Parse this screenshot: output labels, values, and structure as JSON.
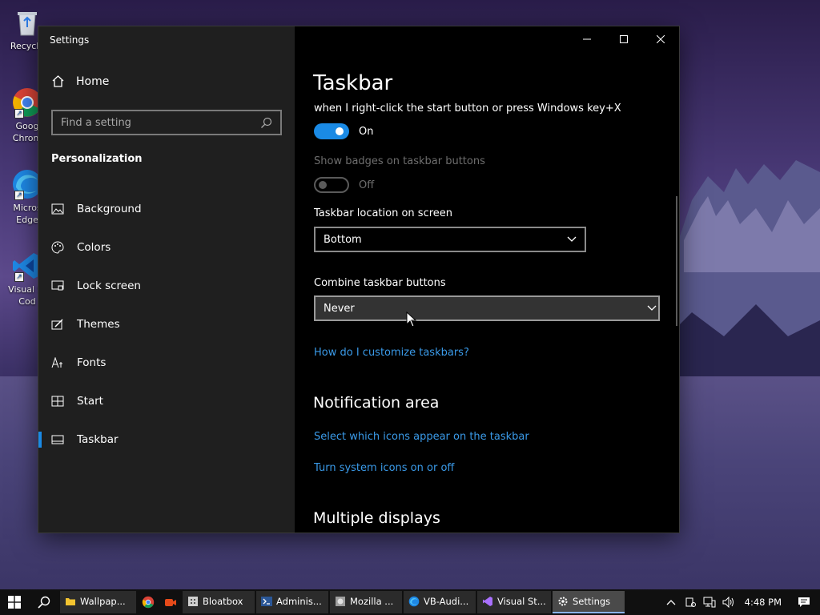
{
  "desktop": {
    "icons": [
      {
        "label": "Recycle"
      },
      {
        "label": "Goog\nChrom"
      },
      {
        "label": "Micros\nEdge"
      },
      {
        "label": "Visual St\nCod"
      }
    ]
  },
  "window": {
    "title": "Settings",
    "controls": {
      "minimize": "minimize-icon",
      "maximize": "maximize-icon",
      "close": "close-icon"
    }
  },
  "sidebar": {
    "home_label": "Home",
    "search_placeholder": "Find a setting",
    "section": "Personalization",
    "items": [
      {
        "label": "Background",
        "icon": "picture-icon"
      },
      {
        "label": "Colors",
        "icon": "palette-icon"
      },
      {
        "label": "Lock screen",
        "icon": "lock-screen-icon"
      },
      {
        "label": "Themes",
        "icon": "brush-icon"
      },
      {
        "label": "Fonts",
        "icon": "font-icon"
      },
      {
        "label": "Start",
        "icon": "start-tiles-icon"
      },
      {
        "label": "Taskbar",
        "icon": "taskbar-icon",
        "active": true
      }
    ]
  },
  "content": {
    "title": "Taskbar",
    "powershell_desc": "when I right-click the start button or press Windows key+X",
    "powershell_toggle": {
      "state": "On"
    },
    "badges_label": "Show badges on taskbar buttons",
    "badges_toggle": {
      "state": "Off"
    },
    "location_label": "Taskbar location on screen",
    "location_value": "Bottom",
    "combine_label": "Combine taskbar buttons",
    "combine_value": "Never",
    "help_link": "How do I customize taskbars?",
    "notification_heading": "Notification area",
    "notif_link1": "Select which icons appear on the taskbar",
    "notif_link2": "Turn system icons on or off",
    "multiple_heading": "Multiple displays"
  },
  "taskbar": {
    "apps": [
      {
        "label": "Wallpap...",
        "icon": "folder-icon"
      },
      {
        "label": "Bloatbox",
        "icon": "bloatbox-icon"
      },
      {
        "label": "Adminis...",
        "icon": "powershell-icon"
      },
      {
        "label": "Mozilla ...",
        "icon": "mozilla-icon"
      },
      {
        "label": "VB-Audi...",
        "icon": "edge-icon"
      },
      {
        "label": "Visual St...",
        "icon": "visual-studio-icon"
      },
      {
        "label": "Settings",
        "icon": "gear-icon",
        "active": true
      }
    ],
    "clock": "4:48 PM"
  },
  "colors": {
    "accent": "#1a8ae5",
    "link": "#3a9ae8",
    "sidebar_bg": "#1f1f1f"
  }
}
